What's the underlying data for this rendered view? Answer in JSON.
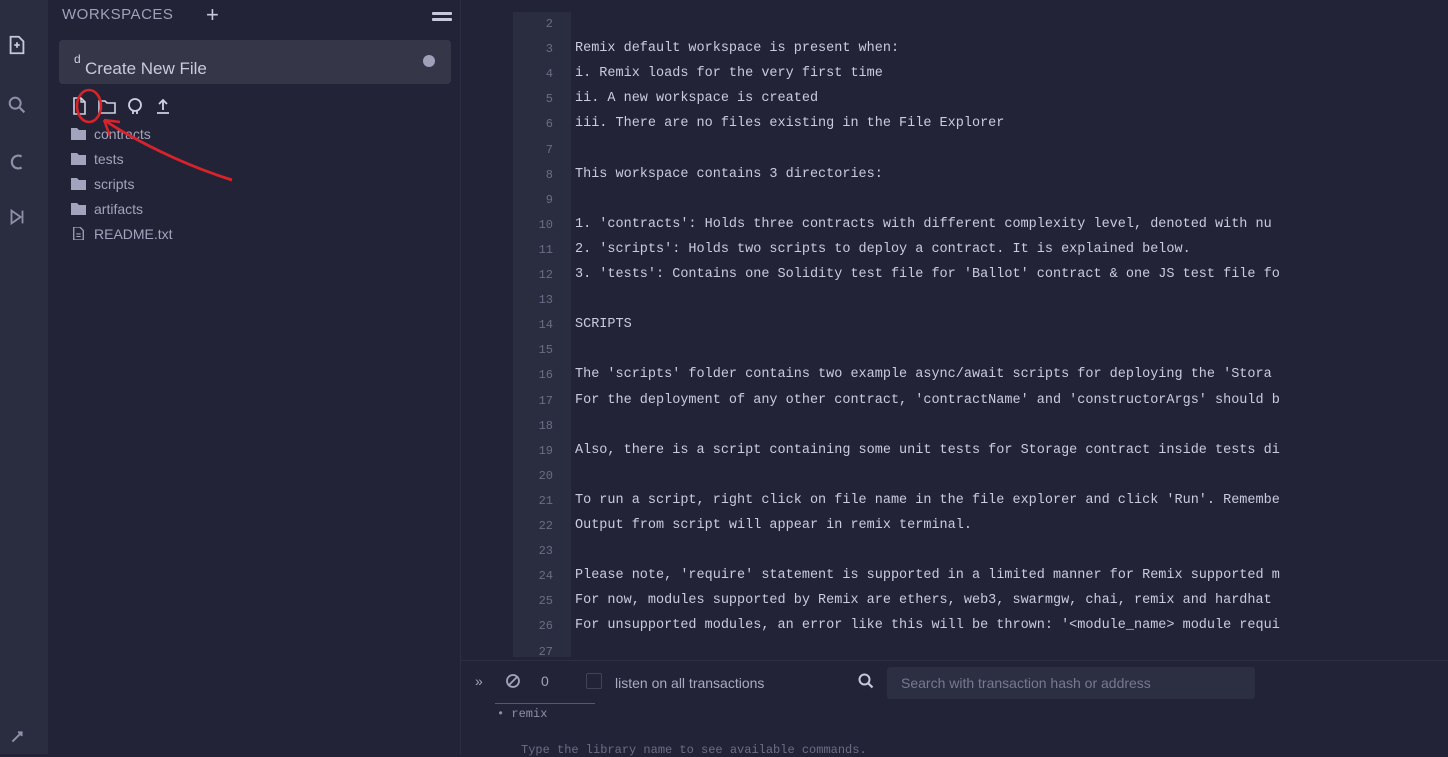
{
  "workspace": {
    "header": "WORKSPACES",
    "add_symbol": "+",
    "selected": "Create New File",
    "selected_prefix": "d"
  },
  "file_tree": [
    {
      "name": "contracts",
      "type": "folder"
    },
    {
      "name": "tests",
      "type": "folder"
    },
    {
      "name": "scripts",
      "type": "folder"
    },
    {
      "name": "artifacts",
      "type": "folder"
    },
    {
      "name": "README.txt",
      "type": "file"
    }
  ],
  "editor": {
    "lines": [
      {
        "n": "2",
        "text": ""
      },
      {
        "n": "3",
        "text": "Remix default workspace is present when:"
      },
      {
        "n": "4",
        "text": "i. Remix loads for the very first time"
      },
      {
        "n": "5",
        "text": "ii. A new workspace is created"
      },
      {
        "n": "6",
        "text": "iii. There are no files existing in the File Explorer"
      },
      {
        "n": "7",
        "text": ""
      },
      {
        "n": "8",
        "text": "This workspace contains 3 directories:"
      },
      {
        "n": "9",
        "text": ""
      },
      {
        "n": "10",
        "text": "1. 'contracts': Holds three contracts with different complexity level, denoted with nu"
      },
      {
        "n": "11",
        "text": "2. 'scripts': Holds two scripts to deploy a contract. It is explained below."
      },
      {
        "n": "12",
        "text": "3. 'tests': Contains one Solidity test file for 'Ballot' contract & one JS test file fo"
      },
      {
        "n": "13",
        "text": ""
      },
      {
        "n": "14",
        "text": "SCRIPTS"
      },
      {
        "n": "15",
        "text": ""
      },
      {
        "n": "16",
        "text": "The 'scripts' folder contains two example async/await scripts for deploying the 'Stora"
      },
      {
        "n": "17",
        "text": "For the deployment of any other contract, 'contractName' and 'constructorArgs' should b"
      },
      {
        "n": "18",
        "text": ""
      },
      {
        "n": "19",
        "text": "Also, there is a script containing some unit tests for Storage contract inside tests di"
      },
      {
        "n": "20",
        "text": ""
      },
      {
        "n": "21",
        "text": "To run a script, right click on file name in the file explorer and click 'Run'. Remembe"
      },
      {
        "n": "22",
        "text": "Output from script will appear in remix terminal."
      },
      {
        "n": "23",
        "text": ""
      },
      {
        "n": "24",
        "text": "Please note, 'require' statement is supported in a limited manner for Remix supported m"
      },
      {
        "n": "25",
        "text": "For now, modules supported by Remix are ethers, web3, swarmgw, chai, remix and hardhat"
      },
      {
        "n": "26",
        "text": "For unsupported modules, an error like this will be thrown: '<module_name> module requi"
      },
      {
        "n": "27",
        "text": ""
      }
    ]
  },
  "terminal": {
    "collapse_symbol": "»",
    "pending_count": "0",
    "listen_label": "listen on all transactions",
    "search_placeholder": "Search with transaction hash or address",
    "output_line": "• remix",
    "hint_line": "Type the library name to see available commands."
  },
  "colors": {
    "background": "#222336",
    "rail": "#2a2c3f",
    "annotation": "#d8232a"
  }
}
